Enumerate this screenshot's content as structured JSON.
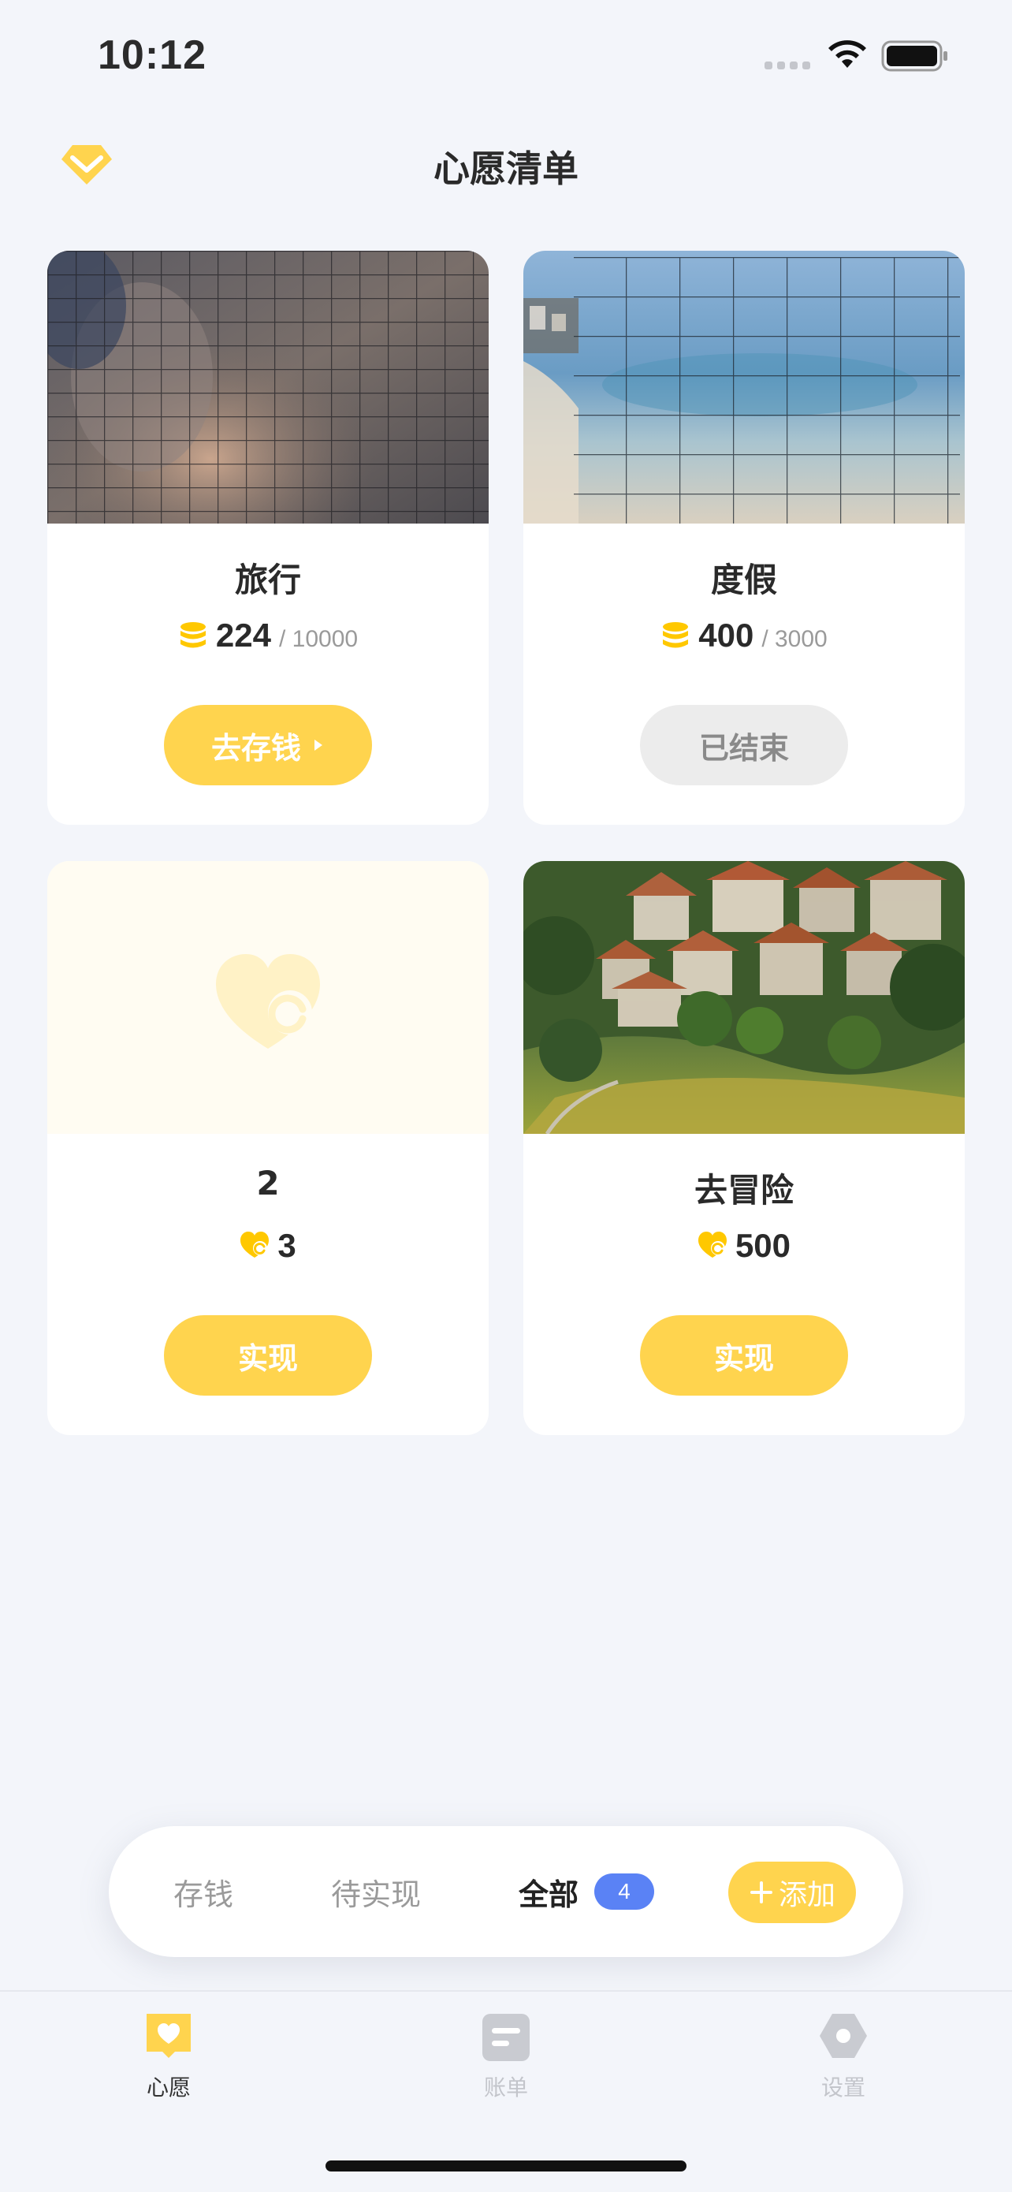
{
  "status_bar": {
    "time": "10:12"
  },
  "header": {
    "title": "心愿清单",
    "left_icon": "diamond-icon"
  },
  "colors": {
    "accent": "#ffd44e",
    "badge": "#5a82f5",
    "background": "#f3f5fa",
    "ended_button": "#ececec"
  },
  "wishes": [
    {
      "title": "旅行",
      "amount_icon": "coin-stack-icon",
      "amount": "224",
      "target": "/ 10000",
      "button": "去存钱",
      "button_state": "active",
      "image": "blurred cat photo"
    },
    {
      "title": "度假",
      "amount_icon": "coin-stack-icon",
      "amount": "400",
      "target": "/ 3000",
      "button": "已结束",
      "button_state": "ended",
      "image": "blurred beach photo"
    },
    {
      "title": "2",
      "amount_icon": "heart-coin-icon",
      "amount": "3",
      "target": "",
      "button": "实现",
      "button_state": "active",
      "image": "placeholder heart"
    },
    {
      "title": "去冒险",
      "amount_icon": "heart-coin-icon",
      "amount": "500",
      "target": "",
      "button": "实现",
      "button_state": "active",
      "image": "hillside village photo"
    }
  ],
  "filter_bar": {
    "tabs": [
      "存钱",
      "待实现",
      "全部"
    ],
    "active_tab": "全部",
    "count": "4",
    "add_label": "添加"
  },
  "tab_bar": {
    "items": [
      {
        "label": "心愿",
        "icon": "wish-icon",
        "active": true
      },
      {
        "label": "账单",
        "icon": "bill-icon",
        "active": false
      },
      {
        "label": "设置",
        "icon": "settings-icon",
        "active": false
      }
    ]
  }
}
